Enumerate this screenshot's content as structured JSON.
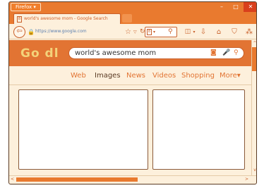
{
  "window": {
    "app_menu_label": "Firefox ▾",
    "minimize_glyph": "–",
    "maximize_glyph": "□",
    "close_glyph": "✕"
  },
  "tab": {
    "title": "world's awesome mom - Google Search",
    "favicon_glyph": "8"
  },
  "navbar": {
    "back_glyph": "⇦",
    "url": "https://www.google.com",
    "lock_glyph": "🔒",
    "bookmark_glyph": "☆",
    "dropdown_glyph": "▽",
    "reload_glyph": "↻",
    "search_engine_glyph": "8",
    "search_caret": "▾",
    "search_glyph": "⚲",
    "sidebar_glyph": "◫",
    "sidebar_caret": "▾",
    "download_glyph": "⇩",
    "home_glyph": "⌂",
    "extension_glyph": "⛉",
    "addons_glyph": "⁂"
  },
  "google": {
    "logo": "Go  dl",
    "query": "world's awesome mom",
    "camera_glyph": "◙",
    "mic_glyph": "🎤",
    "search_glyph": "⚲",
    "tabs": [
      {
        "label": "Web"
      },
      {
        "label": "Images"
      },
      {
        "label": "News"
      },
      {
        "label": "Videos"
      },
      {
        "label": "Shopping"
      },
      {
        "label": "More▾"
      }
    ],
    "active_tab": "Images"
  },
  "scrollbars": {
    "up_glyph": "^",
    "down_glyph": "v",
    "left_glyph": "<",
    "right_glyph": ">"
  },
  "colors": {
    "accent": "#e97a2f",
    "header_orange": "#e27433",
    "background": "#fdf0dc",
    "close_red": "#d9401c",
    "url_blue": "#5b7fb0"
  }
}
